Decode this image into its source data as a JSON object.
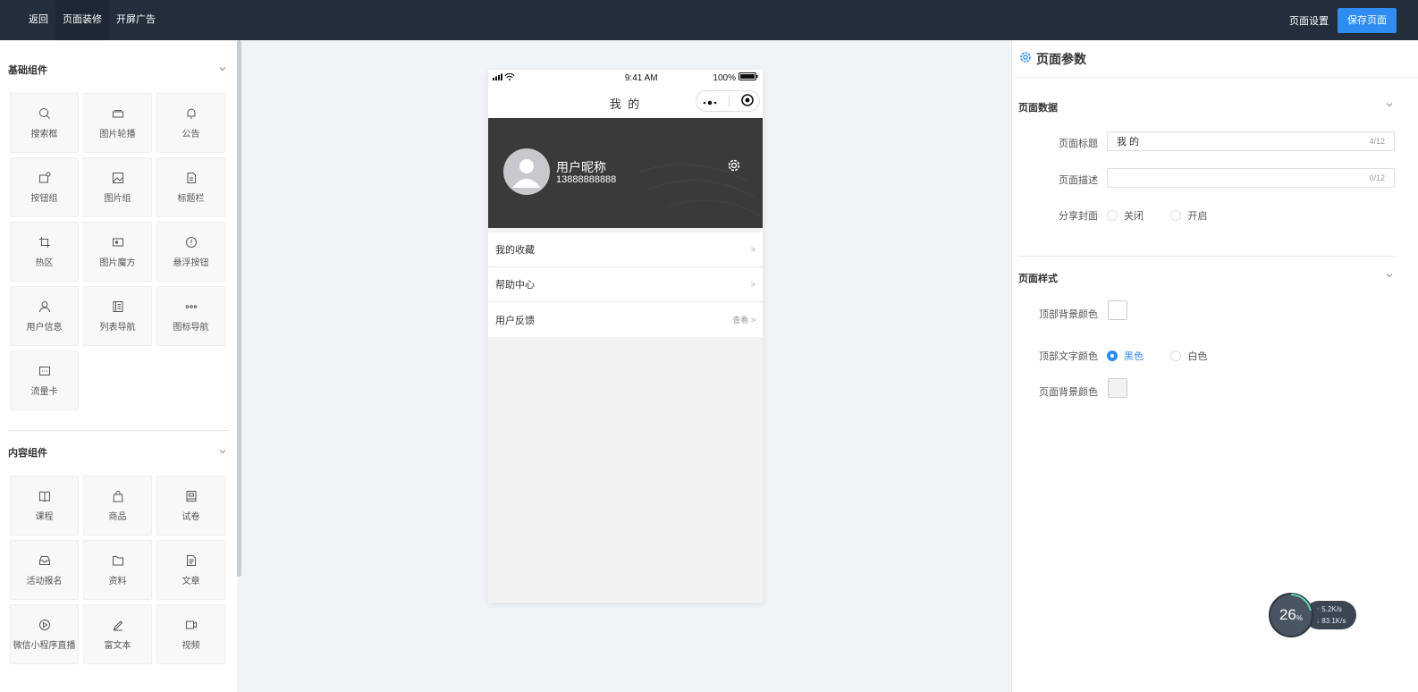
{
  "topbar": {
    "tabs": [
      "返回",
      "页面装修",
      "开屏广告"
    ],
    "right_link": "页面设置",
    "save_label": "保存页面"
  },
  "left_panel": {
    "basic_section": {
      "title": "基础组件",
      "items": [
        {
          "label": "搜索框",
          "icon": "search-icon"
        },
        {
          "label": "图片轮播",
          "icon": "carousel-icon"
        },
        {
          "label": "公告",
          "icon": "bell-icon"
        },
        {
          "label": "按钮组",
          "icon": "button-group-icon"
        },
        {
          "label": "图片组",
          "icon": "image-icon"
        },
        {
          "label": "标题栏",
          "icon": "title-icon"
        },
        {
          "label": "热区",
          "icon": "crop-icon"
        },
        {
          "label": "图片魔方",
          "icon": "image-cube-icon"
        },
        {
          "label": "悬浮按钮",
          "icon": "float-button-icon"
        },
        {
          "label": "用户信息",
          "icon": "user-icon"
        },
        {
          "label": "列表导航",
          "icon": "list-nav-icon"
        },
        {
          "label": "图标导航",
          "icon": "dots-icon"
        },
        {
          "label": "流量卡",
          "icon": "card-icon"
        }
      ]
    },
    "content_section": {
      "title": "内容组件",
      "items": [
        {
          "label": "课程",
          "icon": "book-icon"
        },
        {
          "label": "商品",
          "icon": "bag-icon"
        },
        {
          "label": "试卷",
          "icon": "exam-icon"
        },
        {
          "label": "活动报名",
          "icon": "inbox-icon"
        },
        {
          "label": "资料",
          "icon": "folder-icon"
        },
        {
          "label": "文章",
          "icon": "article-icon"
        },
        {
          "label": "微信小程序直播",
          "icon": "play-icon"
        },
        {
          "label": "富文本",
          "icon": "pen-icon"
        },
        {
          "label": "视频",
          "icon": "video-icon"
        }
      ]
    }
  },
  "phone": {
    "time": "9:41 AM",
    "battery": "100%",
    "title": "我 的",
    "nickname": "用户昵称",
    "phone_number": "13888888888",
    "menu": [
      {
        "label": "我的收藏",
        "right": ""
      },
      {
        "label": "帮助中心",
        "right": ""
      },
      {
        "label": "用户反馈",
        "right": "查看"
      }
    ]
  },
  "right_panel": {
    "header": "页面参数",
    "data_section": "页面数据",
    "title_label": "页面标题",
    "title_value": "我 的",
    "title_count": "4/12",
    "desc_label": "页面描述",
    "desc_value": "",
    "desc_count": "0/12",
    "share_label": "分享封面",
    "share_options": [
      "关闭",
      "开启"
    ],
    "style_section": "页面样式",
    "top_bg_label": "顶部背景颜色",
    "top_text_label": "顶部文字颜色",
    "top_text_options": [
      "黑色",
      "白色"
    ],
    "page_bg_label": "页面背景颜色"
  },
  "speed_widget": {
    "percent": "26",
    "unit": "%",
    "up": "5.2K/s",
    "down": "83.1K/s"
  },
  "colors": {
    "topbar": "#222e3c",
    "accent": "#2f8cf0",
    "banner": "#3a3a3a"
  }
}
